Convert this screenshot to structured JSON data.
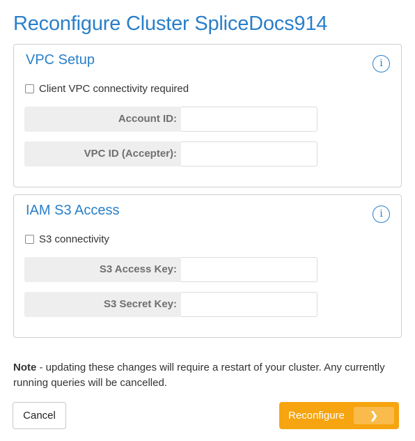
{
  "title": "Reconfigure Cluster SpliceDocs914",
  "vpc": {
    "title": "VPC Setup",
    "info_icon": "i",
    "checkbox_label": "Client VPC connectivity required",
    "account_id_label": "Account ID:",
    "account_id_value": "",
    "vpc_id_label": "VPC ID (Accepter):",
    "vpc_id_value": ""
  },
  "iam": {
    "title": "IAM S3 Access",
    "info_icon": "i",
    "checkbox_label": "S3 connectivity",
    "access_key_label": "S3 Access Key:",
    "access_key_value": "",
    "secret_key_label": "S3 Secret Key:",
    "secret_key_value": ""
  },
  "note": {
    "bold": "Note",
    "text": " - updating these changes will require a restart of your cluster. Any currently running queries will be cancelled."
  },
  "buttons": {
    "cancel": "Cancel",
    "reconfigure": "Reconfigure",
    "chevron": "❯"
  },
  "colors": {
    "accent": "#2a7fc9",
    "primary_button": "#f6a40f"
  },
  "icons": {
    "info": "info-circle-icon",
    "chevron": "chevron-right-icon"
  }
}
